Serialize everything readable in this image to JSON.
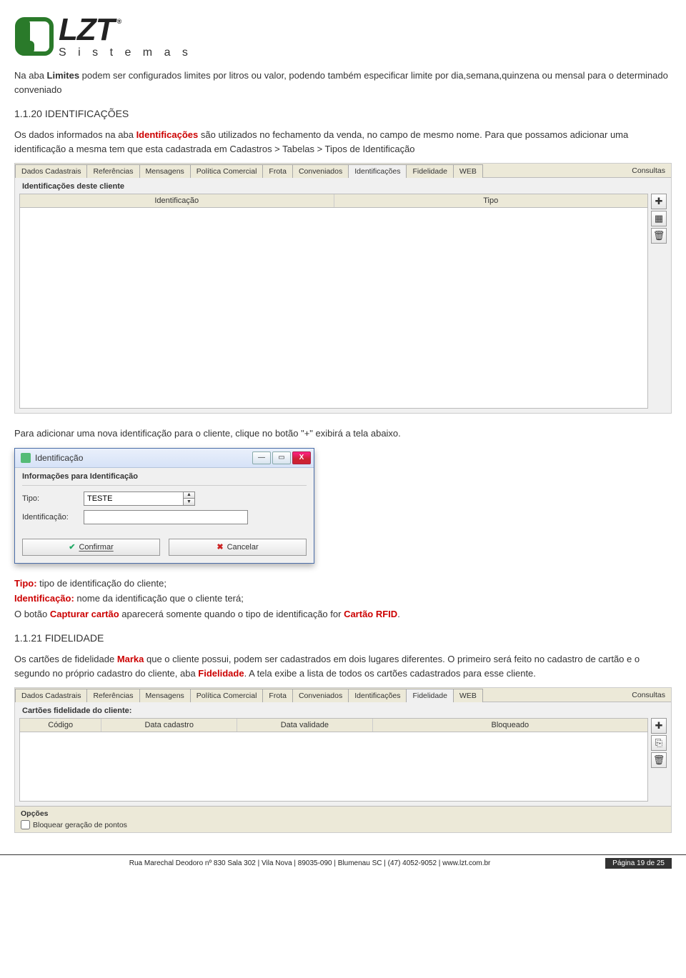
{
  "logo": {
    "lzt": "LZT",
    "reg": "®",
    "sub": "S i s t e m a s"
  },
  "intro_para_prefix": "Na aba ",
  "intro_para_bold": "Limites",
  "intro_para_rest": " podem ser configurados limites por litros ou valor, podendo também especificar limite por dia,semana,quinzena ou mensal para o determinado conveniado",
  "heading1": "1.1.20 IDENTIFICAÇÕES",
  "ident_para1a": "Os dados informados na aba ",
  "ident_para1b": "Identificações",
  "ident_para1c": " são utilizados no fechamento da venda, no campo de mesmo nome. Para que possamos adicionar uma identificação a mesma tem que esta cadastrada em Cadastros > Tabelas > Tipos de Identificação",
  "win1": {
    "tabs": [
      "Dados Cadastrais",
      "Referências",
      "Mensagens",
      "Política Comercial",
      "Frota",
      "Conveniados",
      "Identificações",
      "Fidelidade",
      "WEB"
    ],
    "active_tab_index": 6,
    "right_tab": "Consultas",
    "group": "Identificações deste cliente",
    "cols": [
      "Identificação",
      "Tipo"
    ]
  },
  "ident_para2a": "Para adicionar uma nova identificação para o cliente, clique no botão ",
  "ident_para2b": "\"+\"",
  "ident_para2c": " exibirá a tela abaixo.",
  "dialog": {
    "title": "Identificação",
    "fieldset": "Informações para Identificação",
    "tipo_label": "Tipo:",
    "tipo_value": "TESTE",
    "ident_label": "Identificação:",
    "confirmar": "Confirmar",
    "cancelar": "Cancelar"
  },
  "defs": {
    "tipo_label": "Tipo:",
    "tipo_text": " tipo de identificação do cliente;",
    "ident_label": "Identificação:",
    "ident_text": " nome da identificação que o cliente terá;",
    "cap_pre": "O botão ",
    "cap_bold": "Capturar cartão",
    "cap_mid": " aparecerá somente quando o tipo de identificação for ",
    "cap_bold2": "Cartão RFID",
    "cap_dot": "."
  },
  "heading2": "1.1.21 FIDELIDADE",
  "fid_para_a": "Os cartões de fidelidade ",
  "fid_para_b": "Marka",
  "fid_para_c": " que o cliente possui, podem ser cadastrados em dois lugares diferentes. O primeiro será feito no cadastro de cartão e o segundo no próprio cadastro do cliente, aba ",
  "fid_para_d": "Fidelidade",
  "fid_para_e": ". A tela exibe a lista de todos os cartões cadastrados para esse cliente.",
  "win2": {
    "tabs": [
      "Dados Cadastrais",
      "Referências",
      "Mensagens",
      "Política Comercial",
      "Frota",
      "Conveniados",
      "Identificações",
      "Fidelidade",
      "WEB"
    ],
    "active_tab_index": 7,
    "right_tab": "Consultas",
    "group": "Cartões fidelidade do cliente:",
    "cols": [
      "Código",
      "Data cadastro",
      "Data validade",
      "Bloqueado"
    ],
    "options_label": "Opções",
    "checkbox": "Bloquear geração de pontos"
  },
  "footer": {
    "addr": "Rua Marechal Deodoro nº 830 Sala 302   |   Vila Nova   |   89035-090   |   Blumenau SC   |   (47) 4052-9052   |   www.lzt.com.br",
    "page": "Página  19 de 25"
  }
}
